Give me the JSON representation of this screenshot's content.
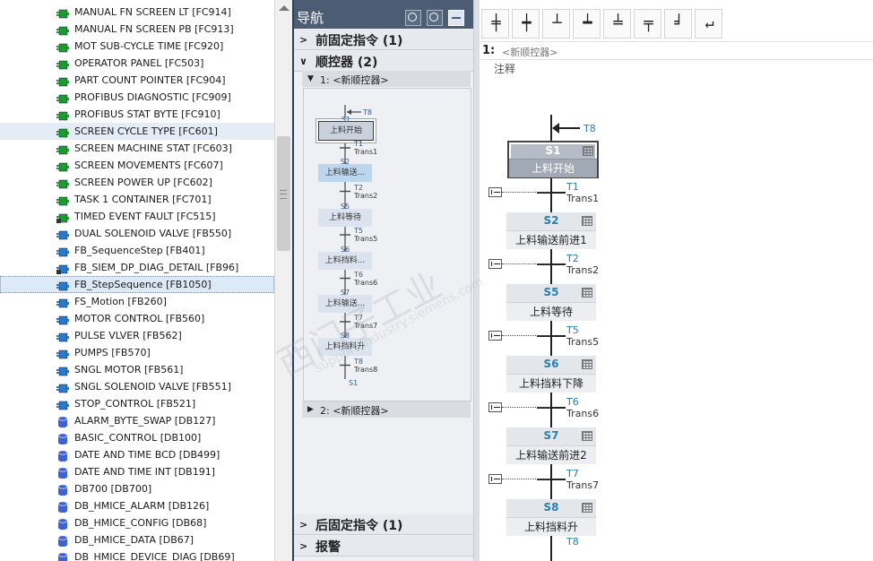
{
  "tree": {
    "items": [
      {
        "label": "MANUAL FN SCREEN LT [FC914]",
        "icon": "fc-block-icon"
      },
      {
        "label": "MANUAL FN SCREEN PB [FC913]",
        "icon": "fc-block-icon"
      },
      {
        "label": "MOT SUB-CYCLE TIME [FC920]",
        "icon": "fc-block-icon"
      },
      {
        "label": "OPERATOR PANEL [FC503]",
        "icon": "fc-block-icon"
      },
      {
        "label": "PART COUNT POINTER [FC904]",
        "icon": "fc-block-icon"
      },
      {
        "label": "PROFIBUS DIAGNOSTIC [FC909]",
        "icon": "fc-block-icon"
      },
      {
        "label": "PROFIBUS STAT BYTE [FC910]",
        "icon": "fc-block-icon"
      },
      {
        "label": "SCREEN CYCLE TYPE [FC601]",
        "icon": "fc-block-icon"
      },
      {
        "label": "SCREEN MACHINE STAT [FC603]",
        "icon": "fc-block-icon"
      },
      {
        "label": "SCREEN MOVEMENTS [FC607]",
        "icon": "fc-block-icon"
      },
      {
        "label": "SCREEN POWER UP [FC602]",
        "icon": "fc-block-icon"
      },
      {
        "label": "TASK 1 CONTAINER [FC701]",
        "icon": "fc-block-icon"
      },
      {
        "label": "TIMED EVENT FAULT [FC515]",
        "icon": "fc-block-locked-icon"
      },
      {
        "label": "DUAL SOLENOID VALVE [FB550]",
        "icon": "fb-block-icon"
      },
      {
        "label": "FB_SequenceStep [FB401]",
        "icon": "fb-block-icon"
      },
      {
        "label": "FB_SIEM_DP_DIAG_DETAIL [FB96]",
        "icon": "fb-block-locked-icon"
      },
      {
        "label": "FB_StepSequence [FB1050]",
        "icon": "fb-block-icon"
      },
      {
        "label": "FS_Motion [FB260]",
        "icon": "fb-block-icon"
      },
      {
        "label": "MOTOR CONTROL [FB560]",
        "icon": "fb-block-icon"
      },
      {
        "label": "PULSE VLVER [FB562]",
        "icon": "fb-block-icon"
      },
      {
        "label": "PUMPS [FB570]",
        "icon": "fb-block-icon"
      },
      {
        "label": "SNGL MOTOR [FB561]",
        "icon": "fb-block-icon"
      },
      {
        "label": "SNGL SOLENOID VALVE [FB551]",
        "icon": "fb-block-icon"
      },
      {
        "label": "STOP_CONTROL [FB521]",
        "icon": "fb-block-icon"
      },
      {
        "label": "ALARM_BYTE_SWAP [DB127]",
        "icon": "db-block-icon"
      },
      {
        "label": "BASIC_CONTROL [DB100]",
        "icon": "db-block-icon"
      },
      {
        "label": "DATE AND TIME BCD [DB499]",
        "icon": "db-block-icon"
      },
      {
        "label": "DATE AND TIME INT [DB191]",
        "icon": "db-block-icon"
      },
      {
        "label": "DB700 [DB700]",
        "icon": "db-block-icon"
      },
      {
        "label": "DB_HMICE_ALARM [DB126]",
        "icon": "db-block-icon"
      },
      {
        "label": "DB_HMICE_CONFIG [DB68]",
        "icon": "db-block-icon"
      },
      {
        "label": "DB_HMICE_DATA [DB67]",
        "icon": "db-block-icon"
      },
      {
        "label": "DB_HMICE_DEVICE_DIAG [DB69]",
        "icon": "db-block-icon"
      }
    ],
    "highlighted_index": 7,
    "selected_index": 16
  },
  "nav": {
    "title": "导航",
    "tools": [
      "zoom-in-icon",
      "zoom-out-icon",
      "fit-width-icon"
    ],
    "pre_instructions": "前固定指令 (1)",
    "sequencers": "顺控器 (2)",
    "seq1": "1: <新顺控器>",
    "seq2": "2: <新顺控器>",
    "post_instructions": "后固定指令 (1)",
    "alarms": "报警",
    "mini": {
      "jump_top": "T8",
      "jump_bottom": "S1",
      "steps": [
        {
          "id": "S1",
          "name": "上料开始"
        },
        {
          "id": "S2",
          "name": "上料输送..."
        },
        {
          "id": "S5",
          "name": "上料等待"
        },
        {
          "id": "S6",
          "name": "上料挡料..."
        },
        {
          "id": "S7",
          "name": "上料输送..."
        },
        {
          "id": "S8",
          "name": "上料挡料升"
        }
      ],
      "transitions": [
        {
          "id": "T1",
          "name": "Trans1"
        },
        {
          "id": "T2",
          "name": "Trans2"
        },
        {
          "id": "T5",
          "name": "Trans5"
        },
        {
          "id": "T6",
          "name": "Trans6"
        },
        {
          "id": "T7",
          "name": "Trans7"
        },
        {
          "id": "T8",
          "name": "Trans8"
        }
      ]
    }
  },
  "editor": {
    "toolbar": [
      {
        "name": "insert-step-transition-button",
        "glyph": "╪"
      },
      {
        "name": "insert-step-button",
        "glyph": "┿"
      },
      {
        "name": "insert-jump-button",
        "glyph": "┴"
      },
      {
        "name": "insert-transition-button",
        "glyph": "┷"
      },
      {
        "name": "insert-simultaneous-branch-button",
        "glyph": "╧"
      },
      {
        "name": "insert-alternative-branch-button",
        "glyph": "╤"
      },
      {
        "name": "close-branch-button",
        "glyph": "╛"
      },
      {
        "name": "insert-return-button",
        "glyph": "↵"
      }
    ],
    "seq_number": "1:",
    "seq_name": "<新顺控器>",
    "comment": "注释",
    "jump_in": "T8",
    "steps": [
      {
        "id": "S1",
        "name": "上料开始",
        "initial": true
      },
      {
        "id": "S2",
        "name": "上料输送前进1",
        "initial": false
      },
      {
        "id": "S5",
        "name": "上料等待",
        "initial": false
      },
      {
        "id": "S6",
        "name": "上料挡料下降",
        "initial": false
      },
      {
        "id": "S7",
        "name": "上料输送前进2",
        "initial": false
      },
      {
        "id": "S8",
        "name": "上料挡料升",
        "initial": false
      }
    ],
    "transitions": [
      {
        "id": "T1",
        "name": "Trans1"
      },
      {
        "id": "T2",
        "name": "Trans2"
      },
      {
        "id": "T5",
        "name": "Trans5"
      },
      {
        "id": "T6",
        "name": "Trans6"
      },
      {
        "id": "T7",
        "name": "Trans7"
      }
    ],
    "next_transition_partial": "T8"
  },
  "watermark": {
    "main": "西门子工业",
    "sub": "support.industry.siemens.com"
  },
  "colors": {
    "nav_header": "#4c5d73",
    "step_id": "#2b7fb0",
    "fc_icon": "#1e9a2e",
    "fb_icon": "#2a78c9",
    "db_icon": "#3e62d6"
  }
}
